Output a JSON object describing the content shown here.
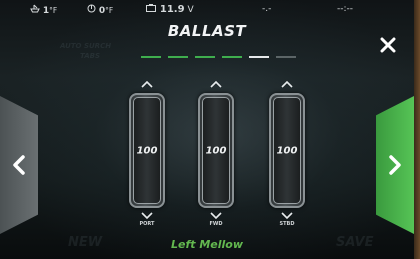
{
  "status_bar": {
    "water_temp": "1",
    "water_temp_unit": "°F",
    "air_temp": "0",
    "air_temp_unit": "°F",
    "battery_voltage": "11.9",
    "battery_unit": "V",
    "field_4": "-.-",
    "clock": "--:--"
  },
  "title": "BALLAST",
  "page_indicator": {
    "count": 6,
    "current": 5,
    "states": [
      "active",
      "active",
      "active",
      "active",
      "current",
      "inactive"
    ]
  },
  "tanks": [
    {
      "value": "100",
      "fill_percent": 100,
      "label": "PORT"
    },
    {
      "value": "100",
      "fill_percent": 100,
      "label": "FWD"
    },
    {
      "value": "100",
      "fill_percent": 100,
      "label": "STBD"
    }
  ],
  "preset_name": "Left Mellow",
  "background_labels": {
    "left_top": "AUTO SURCH",
    "left_top_2": "TABS",
    "bottom_left": "NEW",
    "bottom_right": "SAVE"
  },
  "icons": {
    "close": "close-icon",
    "prev": "chevron-left-icon",
    "next": "chevron-right-icon",
    "tank_up": "chevron-up-icon",
    "tank_down": "chevron-down-icon"
  },
  "colors": {
    "accent_green": "#3fae4e",
    "preset_text": "#63b84f",
    "next_button": "#4cb84c"
  }
}
